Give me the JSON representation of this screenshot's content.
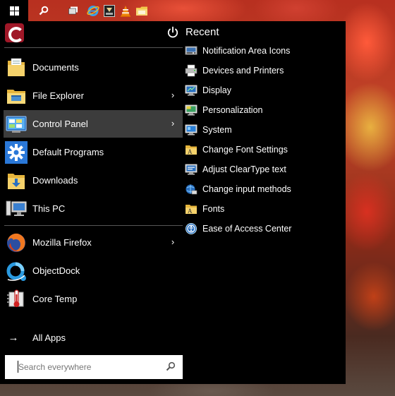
{
  "taskbar": {
    "start_icon": "windows-logo-icon",
    "pinned_icons": [
      "search-icon",
      "task-view-icon",
      "internet-explorer-icon",
      "sandbox-app-icon",
      "vlc-icon",
      "folder-icon"
    ]
  },
  "start_menu": {
    "recent_title": "Recent",
    "left_items": [
      {
        "label": "Documents",
        "icon": "documents-folder-icon",
        "has_submenu": false
      },
      {
        "label": "File Explorer",
        "icon": "file-explorer-icon",
        "has_submenu": true
      },
      {
        "label": "Control Panel",
        "icon": "control-panel-icon",
        "has_submenu": true,
        "active": true
      },
      {
        "label": "Default Programs",
        "icon": "default-programs-gear-icon",
        "has_submenu": false
      },
      {
        "label": "Downloads",
        "icon": "downloads-folder-icon",
        "has_submenu": false
      },
      {
        "label": "This PC",
        "icon": "this-pc-icon",
        "has_submenu": false
      },
      {
        "label": "Mozilla Firefox",
        "icon": "firefox-icon",
        "has_submenu": true
      },
      {
        "label": "ObjectDock",
        "icon": "objectdock-icon",
        "has_submenu": false
      },
      {
        "label": "Core Temp",
        "icon": "core-temp-icon",
        "has_submenu": false
      }
    ],
    "all_apps_label": "All Apps",
    "search_placeholder": "Search everywhere",
    "recent_items": [
      {
        "label": "Notification Area Icons",
        "icon": "notification-area-icon"
      },
      {
        "label": "Devices and Printers",
        "icon": "printer-icon"
      },
      {
        "label": "Display",
        "icon": "display-icon"
      },
      {
        "label": "Personalization",
        "icon": "personalization-icon"
      },
      {
        "label": "System",
        "icon": "system-icon"
      },
      {
        "label": "Change Font Settings",
        "icon": "font-folder-icon"
      },
      {
        "label": "Adjust ClearType text",
        "icon": "cleartype-icon"
      },
      {
        "label": "Change input methods",
        "icon": "input-methods-icon"
      },
      {
        "label": "Fonts",
        "icon": "fonts-folder-icon"
      },
      {
        "label": "Ease of Access Center",
        "icon": "ease-of-access-icon"
      }
    ]
  },
  "colors": {
    "menu_background": "#000000",
    "active_item": "#3c3c3c",
    "divider": "#555555",
    "search_background": "#ffffff"
  }
}
